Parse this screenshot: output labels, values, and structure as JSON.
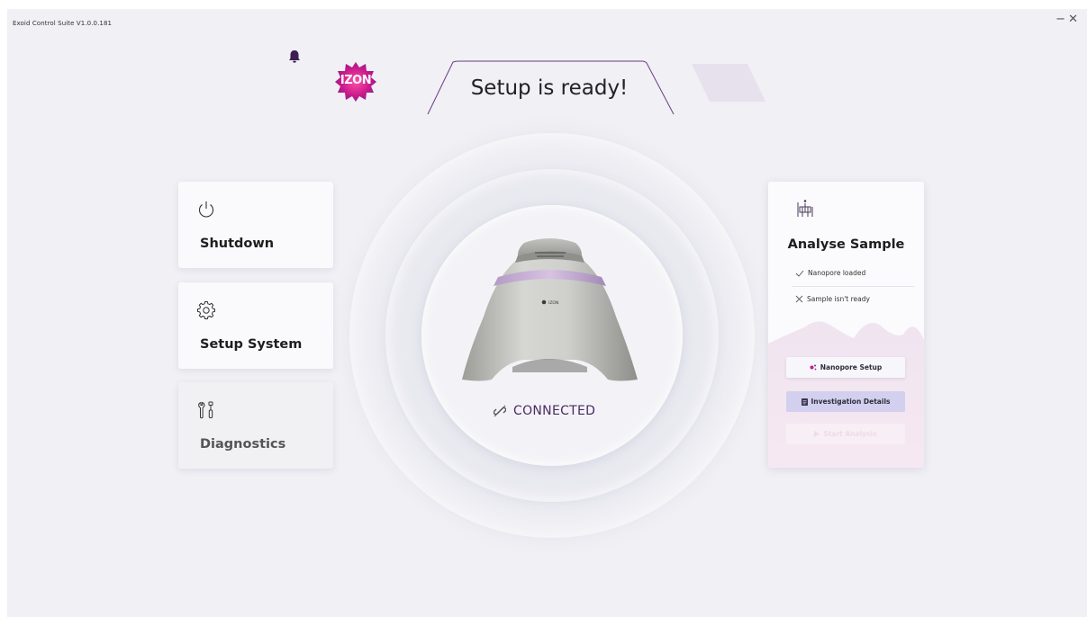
{
  "app": {
    "title": "Exoid Control Suite V1.0.0.181",
    "minimize_glyph": "−",
    "close_glyph": "✕"
  },
  "header": {
    "logo_text": "IZON",
    "title": "Setup is ready!",
    "notification_icon": "bell-icon"
  },
  "left_cards": [
    {
      "label": "Shutdown",
      "icon": "power-icon"
    },
    {
      "label": "Setup System",
      "icon": "gear-icon"
    },
    {
      "label": "Diagnostics",
      "icon": "wrench-screwdriver-icon"
    }
  ],
  "device": {
    "brand_mark": "IZON",
    "status": "CONNECTED",
    "status_icon": "link-icon"
  },
  "analyse": {
    "title": "Analyse Sample",
    "icon": "sample-rack-icon",
    "checks": [
      {
        "text": "Nanopore loaded",
        "state": "ok"
      },
      {
        "text": "Sample isn't ready",
        "state": "fail"
      }
    ],
    "buttons": {
      "nanopore_setup": "Nanopore Setup",
      "investigation_details": "Investigation Details",
      "start_analysis": "Start Analysis"
    }
  },
  "colors": {
    "accent_purple": "#4a2b62",
    "brand_magenta": "#c8198a",
    "background": "#f0f0f5"
  }
}
